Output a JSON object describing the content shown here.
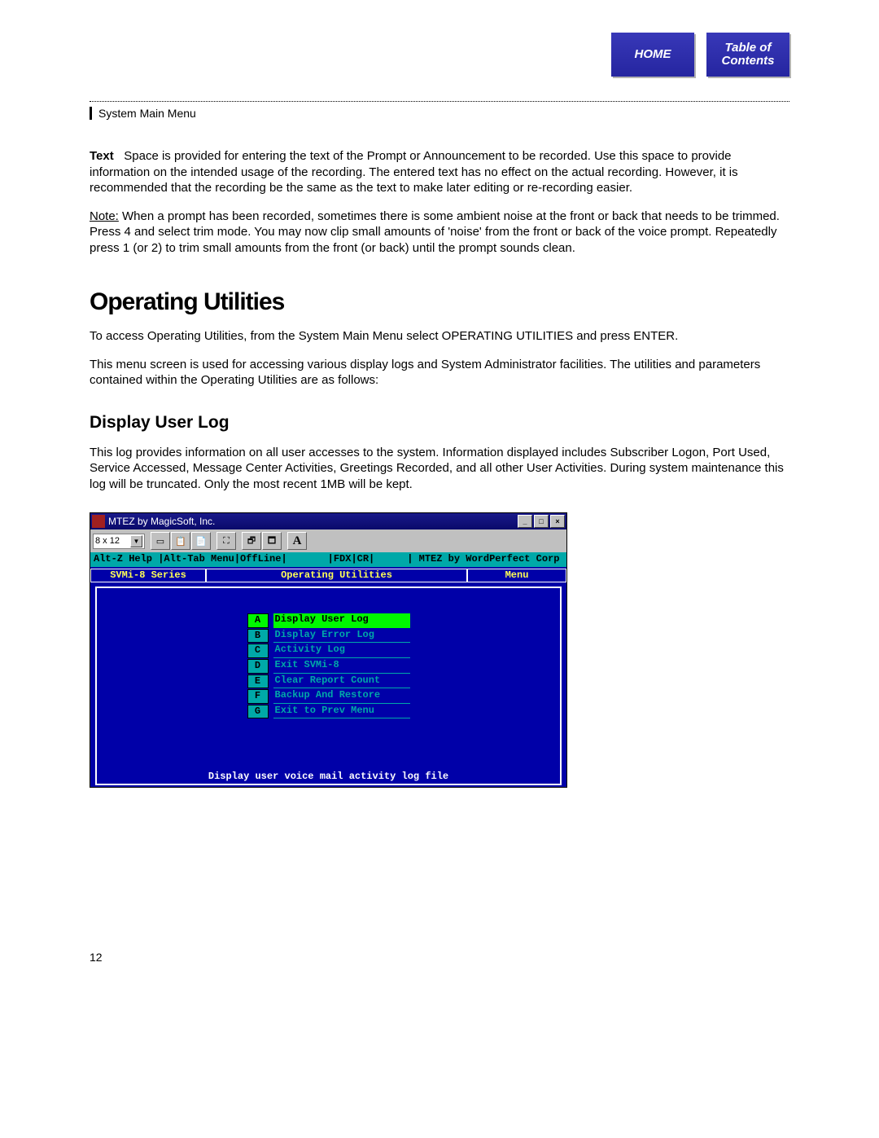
{
  "nav": {
    "home": "HOME",
    "toc": "Table of\nContents"
  },
  "section_label": "System Main Menu",
  "text_para": {
    "label": "Text",
    "body": "Space is provided for entering the text of the Prompt or Announcement to be recorded.  Use this space to provide information on the intended usage of the recording. The entered text has no effect on the actual recording. However, it is recommended that the recording be the same as the text to make later editing or re-recording easier."
  },
  "note_para": {
    "label": "Note:",
    "body": " When a prompt has been recorded, sometimes there is some ambient noise at the front or back that needs to be trimmed. Press 4 and select trim mode. You may now clip small amounts of 'noise' from the front or back of the voice prompt. Repeatedly press 1 (or 2) to trim small amounts from the front (or back) until the prompt sounds clean."
  },
  "heading1": "Operating Utilities",
  "para2": "To access Operating Utilities, from the System Main Menu select OPERATING UTILITIES and press ENTER.",
  "para3": "This menu screen is used for accessing various display logs and System Administrator facilities.  The utilities and parameters contained within the Operating Utilities are as follows:",
  "heading2": "Display User Log",
  "para4": "This log provides information on all user accesses to the system. Information displayed includes Subscriber Logon, Port Used, Service Accessed, Message Center Activities, Greetings Recorded, and all other User Activities. During system maintenance this log will be truncated. Only the most recent 1MB will be kept.",
  "terminal": {
    "titlebar": "MTEZ by MagicSoft, Inc.",
    "font_select": "8 x 12",
    "statusbar": {
      "left": "Alt-Z Help |Alt-Tab Menu|OffLine|",
      "mid": "|FDX|CR|",
      "right": "| MTEZ by WordPerfect Corp"
    },
    "header": {
      "left": "SVMi-8 Series",
      "center": "Operating Utilities",
      "right": "Menu"
    },
    "menu": [
      {
        "key": "A",
        "label": "Display User Log",
        "selected": true
      },
      {
        "key": "B",
        "label": "Display Error Log",
        "selected": false
      },
      {
        "key": "C",
        "label": "Activity Log",
        "selected": false
      },
      {
        "key": "D",
        "label": "Exit SVMi-8",
        "selected": false
      },
      {
        "key": "E",
        "label": "Clear Report Count",
        "selected": false
      },
      {
        "key": "F",
        "label": "Backup And Restore",
        "selected": false
      },
      {
        "key": "G",
        "label": "Exit to Prev Menu",
        "selected": false
      }
    ],
    "footer": "Display user voice mail activity log file"
  },
  "page_number": "12"
}
